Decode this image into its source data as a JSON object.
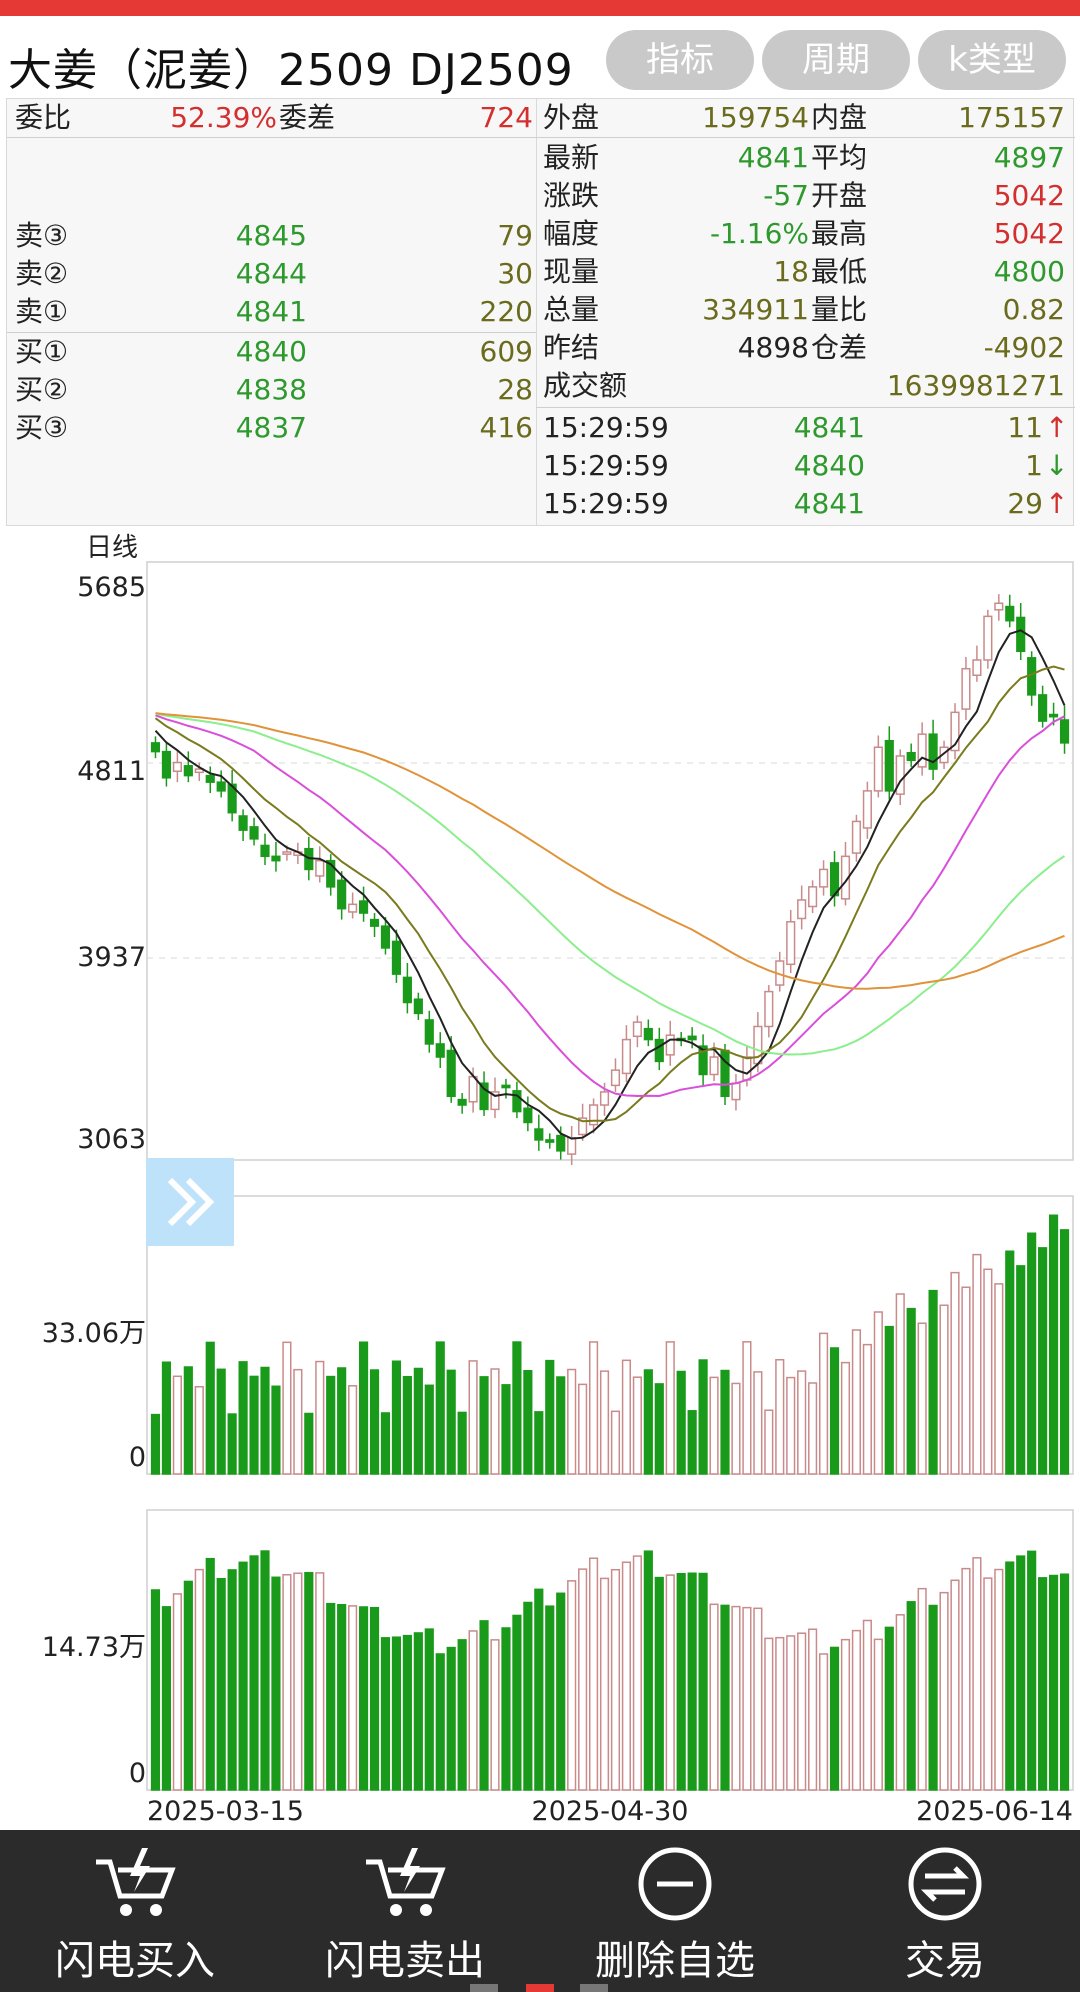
{
  "header": {
    "title": "大姜（泥姜）2509 DJ2509",
    "buttons": [
      "指标",
      "周期",
      "k类型"
    ]
  },
  "quote_left": {
    "weibi_label": "委比",
    "weibi_value": "52.39%",
    "weicha_label": "委差",
    "weicha_value": "724",
    "sells": [
      {
        "label": "卖③",
        "price": "4845",
        "vol": "79"
      },
      {
        "label": "卖②",
        "price": "4844",
        "vol": "30"
      },
      {
        "label": "卖①",
        "price": "4841",
        "vol": "220"
      }
    ],
    "buys": [
      {
        "label": "买①",
        "price": "4840",
        "vol": "609"
      },
      {
        "label": "买②",
        "price": "4838",
        "vol": "28"
      },
      {
        "label": "买③",
        "price": "4837",
        "vol": "416"
      }
    ]
  },
  "quote_right": {
    "rows": [
      {
        "l1": "外盘",
        "v1": "159754",
        "l2": "内盘",
        "v2": "175157"
      },
      {
        "l1": "最新",
        "v1": "4841",
        "l2": "平均",
        "v2": "4897"
      },
      {
        "l1": "涨跌",
        "v1": "-57",
        "l2": "开盘",
        "v2": "5042"
      },
      {
        "l1": "幅度",
        "v1": "-1.16%",
        "l2": "最高",
        "v2": "5042"
      },
      {
        "l1": "现量",
        "v1": "18",
        "l2": "最低",
        "v2": "4800"
      },
      {
        "l1": "总量",
        "v1": "334911",
        "l2": "量比",
        "v2": "0.82"
      },
      {
        "l1": "昨结",
        "v1": "4898",
        "l2": "仓差",
        "v2": "-4902"
      }
    ],
    "turnover_label": "成交额",
    "turnover_value": "1639981271",
    "ticks": [
      {
        "time": "15:29:59",
        "price": "4841",
        "vol": "11",
        "dir": "↑"
      },
      {
        "time": "15:29:59",
        "price": "4840",
        "vol": "1",
        "dir": "↓"
      },
      {
        "time": "15:29:59",
        "price": "4841",
        "vol": "29",
        "dir": "↑"
      }
    ]
  },
  "chart": {
    "period_label": "日线",
    "price_axis": [
      "5685",
      "4811",
      "3937",
      "3063"
    ],
    "vol_axis": [
      "33.06万",
      "0"
    ],
    "oi_axis": [
      "14.73万",
      "0"
    ],
    "dates": [
      "2025-03-15",
      "2025-04-30",
      "2025-06-14"
    ]
  },
  "dock": {
    "items": [
      "闪电买入",
      "闪电卖出",
      "删除自选",
      "交易"
    ]
  },
  "colors": {
    "up": "#d32f2f",
    "down": "#2e9a2e",
    "candle_down_fill": "#1a9a1a",
    "candle_up_stroke": "#c98a8a",
    "ma5": "#222222",
    "ma10": "#7a7a1e",
    "ma20": "#d94fd9",
    "ma40": "#8cee8c",
    "ma60": "#e0933a"
  },
  "chart_data": {
    "type": "candlestick",
    "period": "日线",
    "ylim": [
      3063,
      5685
    ],
    "x_start": "2025-03-15",
    "x_mid": "2025-04-30",
    "x_end": "2025-06-14",
    "closes": [
      4880,
      4760,
      4830,
      4770,
      4800,
      4740,
      4700,
      4600,
      4520,
      4480,
      4400,
      4380,
      4420,
      4420,
      4340,
      4380,
      4260,
      4160,
      4180,
      4140,
      4080,
      3980,
      3860,
      3730,
      3680,
      3540,
      3480,
      3300,
      3260,
      3390,
      3240,
      3320,
      3340,
      3230,
      3180,
      3100,
      3090,
      3050,
      3110,
      3200,
      3260,
      3320,
      3420,
      3560,
      3640,
      3560,
      3460,
      3580,
      3560,
      3560,
      3400,
      3480,
      3300,
      3360,
      3480,
      3620,
      3780,
      3920,
      4100,
      4200,
      4260,
      4340,
      4220,
      4400,
      4560,
      4700,
      4900,
      4700,
      4860,
      4840,
      4960,
      4800,
      4900,
      5060,
      5260,
      5300,
      5500,
      5560,
      5480,
      5340,
      5140,
      5020,
      5040,
      4920
    ]
  }
}
